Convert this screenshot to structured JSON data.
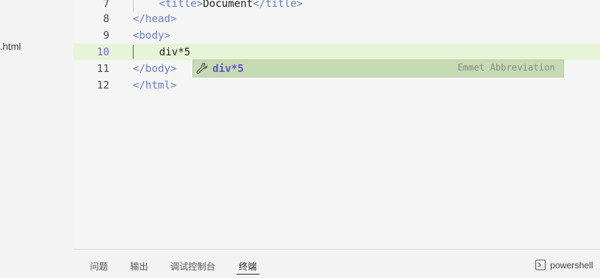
{
  "sidebar": {
    "file_name": ".html"
  },
  "editor": {
    "lines": [
      {
        "n": "7",
        "open": "<",
        "tag": "title",
        "close": ">",
        "text": "Document",
        "end": "</title>"
      },
      {
        "n": "8",
        "text": "</head>"
      },
      {
        "n": "9",
        "text": "<body>"
      },
      {
        "n": "10",
        "text": "div*5"
      },
      {
        "n": "11",
        "text": "</body>"
      },
      {
        "n": "12",
        "text": "</html>"
      }
    ]
  },
  "suggest": {
    "label": "div*5",
    "detail": "Emmet Abbreviation",
    "icon": "wrench-icon"
  },
  "panel": {
    "tabs": [
      {
        "label": "问题"
      },
      {
        "label": "输出"
      },
      {
        "label": "调试控制台"
      },
      {
        "label": "终端"
      }
    ],
    "shell_label": "powershell"
  }
}
